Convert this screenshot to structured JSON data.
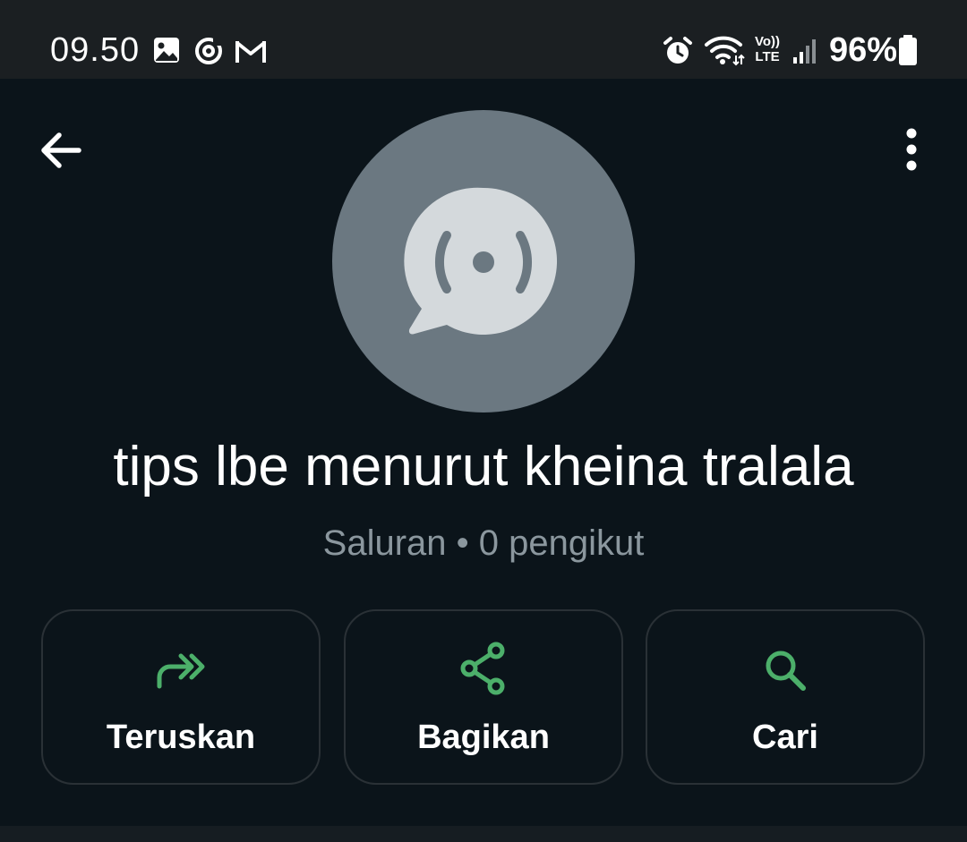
{
  "status_bar": {
    "time": "09.50",
    "battery_percent": "96%",
    "network_label_top": "Vo))",
    "network_label_bottom": "LTE"
  },
  "header": {
    "back_icon": "arrow-left-icon",
    "menu_icon": "more-vertical-icon"
  },
  "channel": {
    "avatar_icon": "channel-broadcast-icon",
    "name": "tips lbe menurut kheina tralala",
    "meta": "Saluran • 0 pengikut"
  },
  "actions": [
    {
      "label": "Teruskan",
      "icon": "forward-icon"
    },
    {
      "label": "Bagikan",
      "icon": "share-icon"
    },
    {
      "label": "Cari",
      "icon": "search-icon"
    }
  ],
  "colors": {
    "background": "#0b141a",
    "accent_green": "#4caf6a",
    "avatar_bg": "#6b7881",
    "avatar_fg": "#d4d9dc",
    "muted_text": "#8b979e"
  }
}
